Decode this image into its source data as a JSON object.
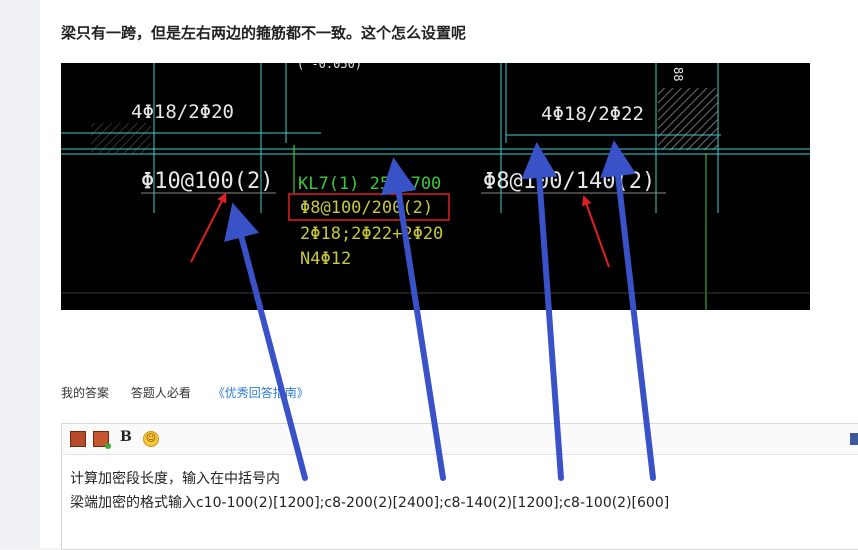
{
  "question": {
    "title": "梁只有一跨，但是左右两边的箍筋都不一致。这个怎么设置呢"
  },
  "cad_drawing": {
    "top_fragment": "( -0.050)",
    "left_column_rebar": "4Φ18/2Φ20",
    "right_column_rebar": "4Φ18/2Φ22",
    "left_stirrup": "Φ10@100(2)",
    "right_stirrup": "Φ8@100/140(2)",
    "beam_label": "KL7(1) 250x700",
    "beam_stirrup": "Φ8@100/200(2)",
    "beam_long_rebar": "2Φ18;2Φ22+2Φ20",
    "beam_side_rebar": "N4Φ12",
    "side_symbol": "88"
  },
  "answer_links": {
    "my_answer": "我的答案",
    "must_read": "答题人必看",
    "guide": "《优秀回答指南》"
  },
  "editor": {
    "toolbar": {
      "image_icon": "image-icon",
      "multi_image_icon": "multi-image-icon",
      "bold_label": "B",
      "emoji_icon": "emoji-icon",
      "fullscreen_icon": "fullscreen-icon"
    },
    "lines": [
      "计算加密段长度，输入在中括号内",
      "梁端加密的格式输入c10-100(2)[1200];c8-200(2)[2400];c8-140(2)[1200];c8-100(2)[600]"
    ]
  },
  "colors": {
    "cad_bg": "#000000",
    "cad_line": "#3fcfcf",
    "cad_text_white": "#e8e8e8",
    "cad_text_yellow": "#c8c83a",
    "cad_text_green": "#3ec83e",
    "red_box": "#e02020",
    "arrow_blue": "#3a52c8",
    "arrow_red": "#e02020"
  }
}
